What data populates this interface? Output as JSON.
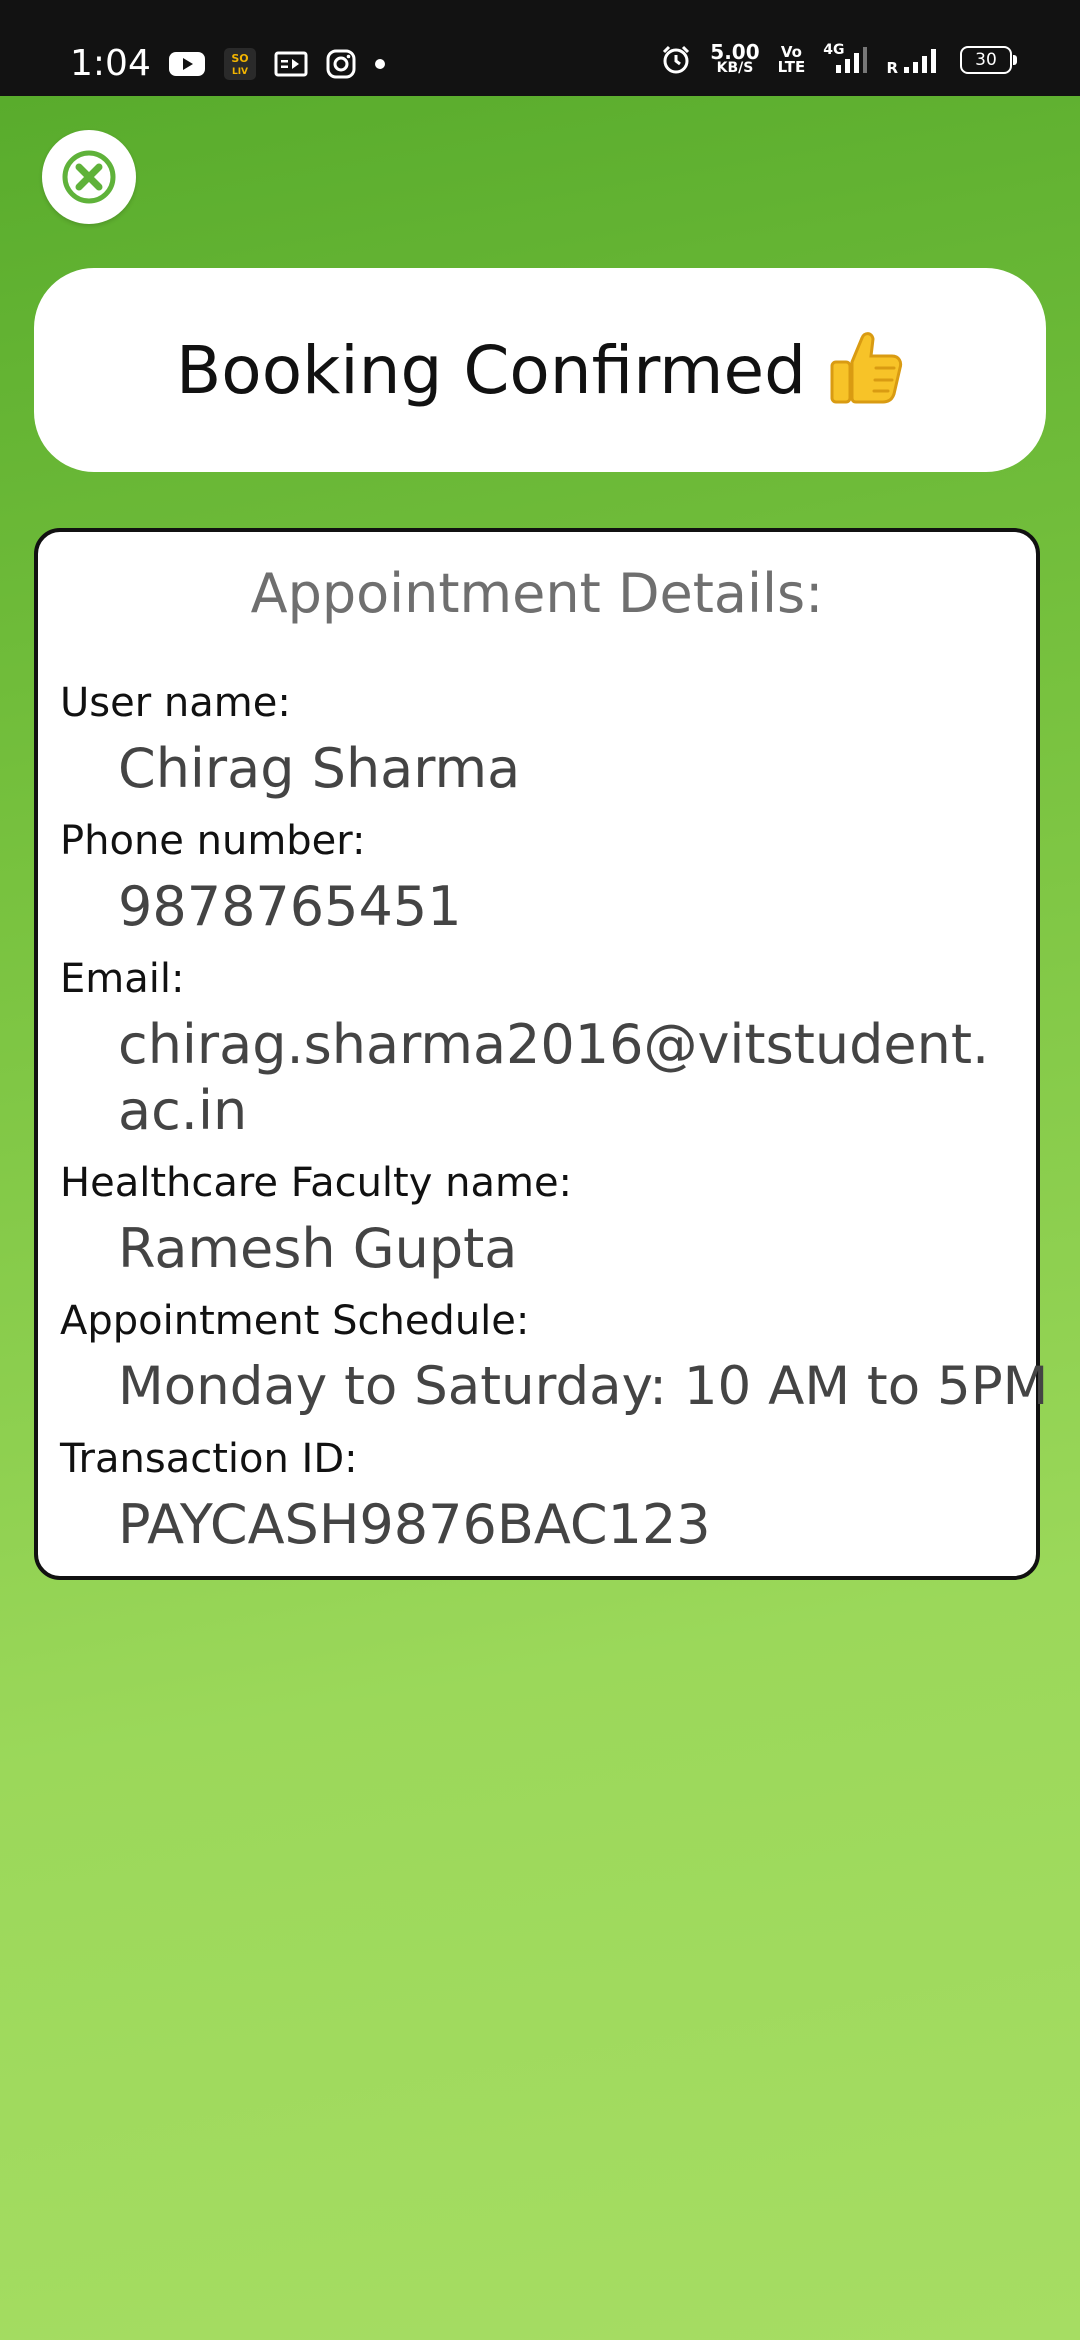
{
  "status_bar": {
    "time": "1:04",
    "net_speed_value": "5.00",
    "net_speed_unit": "KB/S",
    "volte_top": "Vo",
    "volte_bottom": "LTE",
    "network_type": "4G",
    "roaming": "R",
    "battery_level": "30",
    "icons_left": [
      "youtube-icon",
      "sony-liv-icon",
      "media-icon",
      "instagram-icon",
      "dot-icon"
    ],
    "icons_right": [
      "alarm-icon",
      "net-speed",
      "volte-icon",
      "signal-4g-icon",
      "signal-icon",
      "battery-icon"
    ]
  },
  "colors": {
    "status_bar_bg": "#121212",
    "gradient_top": "#55a92a",
    "gradient_bottom": "#a6dd63",
    "close_icon": "#5fb23a"
  },
  "close_button": {
    "icon": "close-icon"
  },
  "header": {
    "title": "Booking Confirmed",
    "icon": "thumbs-up-icon"
  },
  "details": {
    "title": "Appointment Details:",
    "fields": [
      {
        "label": "User name:",
        "value": "Chirag Sharma"
      },
      {
        "label": "Phone number:",
        "value": "9878765451"
      },
      {
        "label": "Email:",
        "value": "chirag.sharma2016@vitstudent.ac.in"
      },
      {
        "label": "Healthcare Faculty name:",
        "value": "Ramesh Gupta"
      },
      {
        "label": "Appointment Schedule:",
        "value": "Monday to Saturday: 10 AM to 5PM"
      },
      {
        "label": "Transaction ID:",
        "value": "PAYCASH9876BAC123"
      }
    ]
  }
}
